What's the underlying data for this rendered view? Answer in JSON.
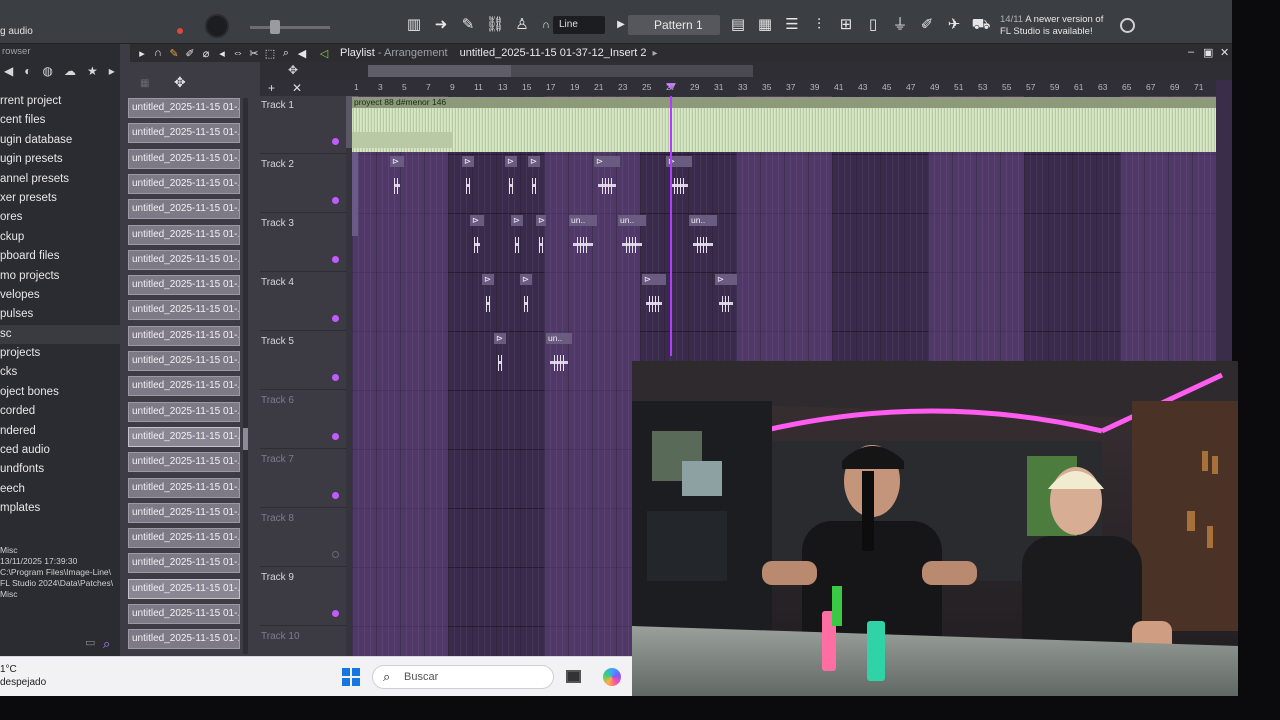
{
  "topbar": {
    "left_title": "g audio",
    "mode_select": "Line",
    "pattern": "Pattern 1",
    "notice_date": "14/11",
    "notice_text": "A newer version of FL Studio is available!"
  },
  "browser": {
    "header": "rowser",
    "items": [
      "rrent project",
      "cent files",
      "ugin database",
      "ugin presets",
      "annel presets",
      "xer presets",
      "ores",
      "ckup",
      "pboard files",
      "mo projects",
      "velopes",
      "pulses",
      "sc",
      "projects",
      "cks",
      "oject bones",
      "corded",
      "ndered",
      "ced audio",
      "undfonts",
      "eech",
      "mplates"
    ],
    "info_lines": [
      "Misc",
      "13/11/2025 17:39:30",
      "C:\\Program Files\\Image-Line\\",
      "FL Studio 2024\\Data\\Patches\\",
      "Misc"
    ]
  },
  "cliplist": {
    "items": [
      "untitled_2025-11-15 01-...",
      "untitled_2025-11-15 01-...",
      "untitled_2025-11-15 01-...",
      "untitled_2025-11-15 01-...",
      "untitled_2025-11-15 01-...",
      "untitled_2025-11-15 01-...",
      "untitled_2025-11-15 01-...",
      "untitled_2025-11-15 01-...",
      "untitled_2025-11-15 01-...",
      "untitled_2025-11-15 01-...",
      "untitled_2025-11-15 01-...",
      "untitled_2025-11-15 01-...",
      "untitled_2025-11-15 01-...",
      "untitled_2025-11-15 01-...",
      "untitled_2025-11-15 01-...",
      "untitled_2025-11-15 01-...",
      "untitled_2025-11-15 01-...",
      "untitled_2025-11-15 01-...",
      "untitled_2025-11-15 01-...",
      "untitled_2025-11-15 01-...",
      "untitled_2025-11-15 01-...",
      "untitled_2025-11-15 01-..."
    ]
  },
  "playlist": {
    "title": "Playlist",
    "title_sub": "- Arrangement",
    "project": "untitled_2025-11-15 01-37-12_Insert 2",
    "ruler": [
      "1",
      "3",
      "5",
      "7",
      "9",
      "11",
      "13",
      "15",
      "17",
      "19",
      "21",
      "23",
      "25",
      "27",
      "29",
      "31",
      "33",
      "35",
      "37",
      "39",
      "41",
      "43",
      "45",
      "47",
      "49",
      "51",
      "53",
      "55",
      "57",
      "59",
      "61",
      "63",
      "65",
      "67",
      "69",
      "71"
    ],
    "tracks": [
      "Track 1",
      "Track 2",
      "Track 3",
      "Track 4",
      "Track 5",
      "Track 6",
      "Track 7",
      "Track 8",
      "Track 9",
      "Track 10"
    ],
    "main_clip": "proyect 88 d#menor 146",
    "short_clip": "un.."
  },
  "taskbar": {
    "weather_temp": "1°C",
    "weather_desc": "despejado",
    "search_placeholder": "Buscar"
  },
  "colors": {
    "accent": "#c05cff",
    "playlist_bg": "#3a2a4b",
    "clip_audio": "#cfe0bd"
  }
}
